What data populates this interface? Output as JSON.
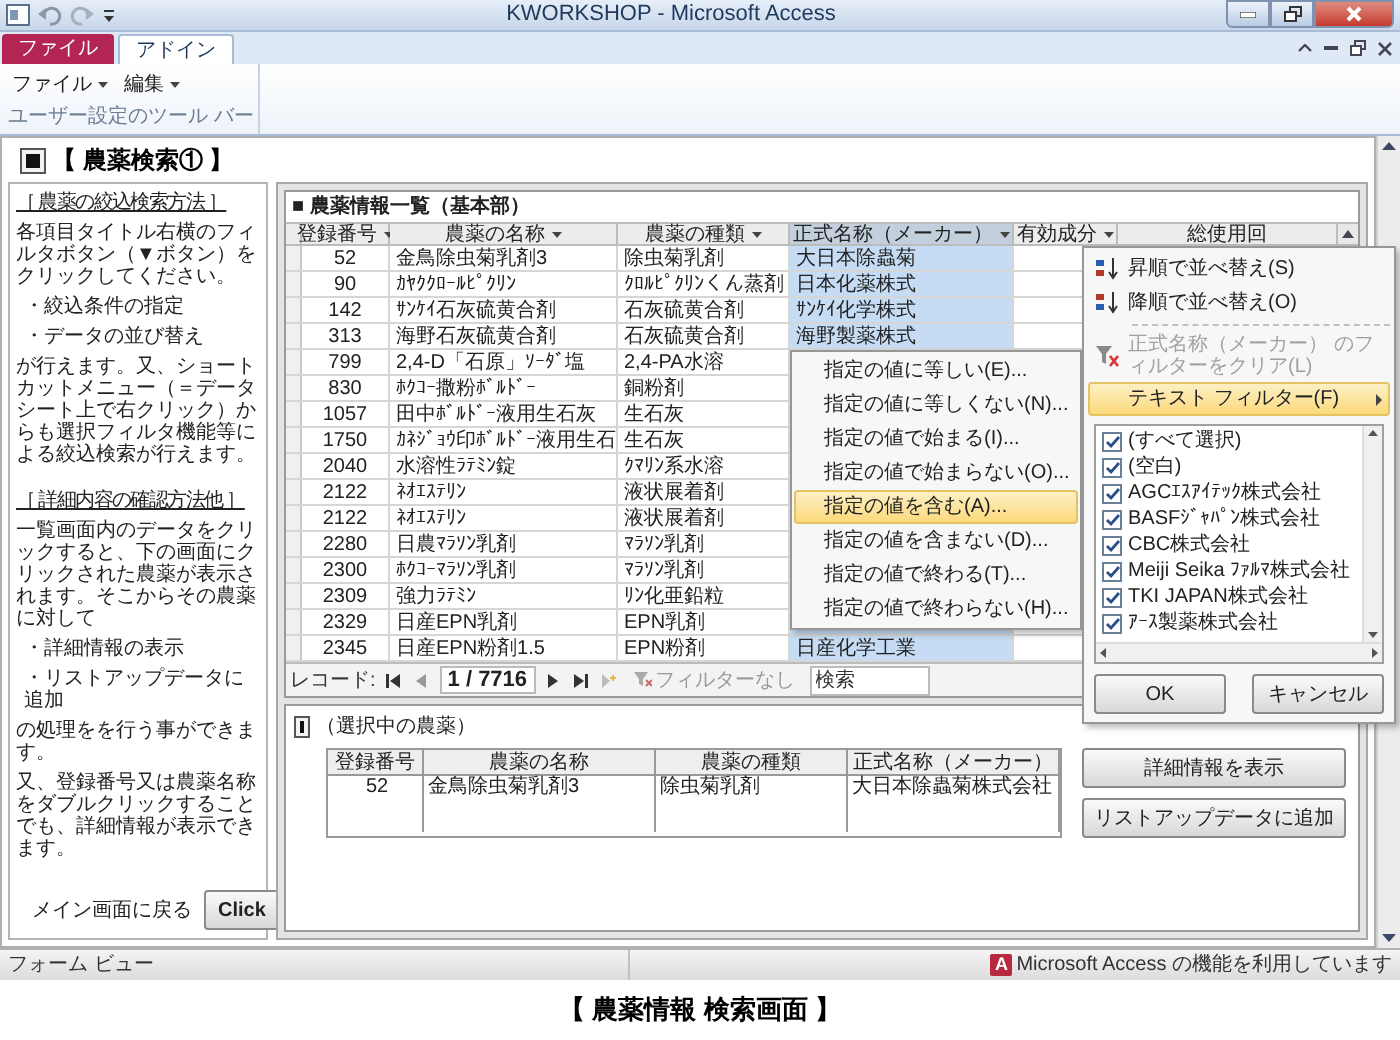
{
  "window": {
    "title": "KWORKSHOP - Microsoft Access"
  },
  "ribbon": {
    "tabs": [
      {
        "label": "ファイル",
        "kind": "file",
        "selected": false
      },
      {
        "label": "アドイン",
        "kind": "tab",
        "selected": true
      }
    ],
    "menus": [
      "ファイル",
      "編集"
    ],
    "group_label": "ユーザー設定のツール バー"
  },
  "form": {
    "title": "【 農薬検索① 】",
    "help": [
      {
        "kind": "heading",
        "text": "［ 農薬の絞込検索方法 ］"
      },
      {
        "kind": "paragraph",
        "text": "各項目タイトル右横のフィルタボタン（▼ボタン）をクリックしてください。"
      },
      {
        "kind": "bullet",
        "text": "・絞込条件の指定"
      },
      {
        "kind": "bullet",
        "text": "・データの並び替え"
      },
      {
        "kind": "paragraph",
        "text": "が行えます。又、ショートカットメニュー（＝データシート上で右クリック）からも選択フィルタ機能等による絞込検索が行えます。"
      },
      {
        "kind": "heading",
        "text": "［ 詳細内容の確認方法他 ］"
      },
      {
        "kind": "paragraph",
        "text": "一覧画面内のデータをクリックすると、下の画面にクリックされた農薬が表示されます。そこからその農薬に対して"
      },
      {
        "kind": "bullet",
        "text": "・詳細情報の表示"
      },
      {
        "kind": "bullet",
        "text": "・リストアップデータに追加"
      },
      {
        "kind": "paragraph",
        "text": "の処理をを行う事ができます。"
      },
      {
        "kind": "paragraph",
        "text": "又、登録番号又は農薬名称をダブルクリックすることでも、詳細情報が表示できます。"
      }
    ],
    "back": {
      "label": "メイン画面に戻る",
      "button": "Click"
    },
    "list": {
      "title": "■ 農薬情報一覧（基本部）",
      "columns": [
        {
          "label": "登録番号",
          "selected": false
        },
        {
          "label": "農薬の名称",
          "selected": false
        },
        {
          "label": "農薬の種類",
          "selected": false
        },
        {
          "label": "正式名称（メーカー）",
          "selected": true
        },
        {
          "label": "有効成分",
          "selected": false
        },
        {
          "label": "総使用回",
          "selected": false
        }
      ],
      "rows": [
        [
          "52",
          "金鳥除虫菊乳剤3",
          "除虫菊乳剤",
          "大日本除蟲菊"
        ],
        [
          "90",
          "ｶﾔｸｸﾛｰﾙﾋﾟｸﾘﾝ",
          "ｸﾛﾙﾋﾟｸﾘﾝくん蒸剤",
          "日本化薬株式"
        ],
        [
          "142",
          "ｻﾝｹｲ石灰硫黄合剤",
          "石灰硫黄合剤",
          "ｻﾝｹｲ化学株式"
        ],
        [
          "313",
          "海野石灰硫黄合剤",
          "石灰硫黄合剤",
          "海野製薬株式"
        ],
        [
          "799",
          "2,4-D「石原」ｿｰﾀﾞ塩",
          "2,4-PA水溶"
        ],
        [
          "830",
          "ﾎｸｺｰ撒粉ﾎﾞﾙﾄﾞｰ",
          "銅粉剤"
        ],
        [
          "1057",
          "田中ﾎﾞﾙﾄﾞｰ液用生石灰",
          "生石灰"
        ],
        [
          "1750",
          "ｶﾈｼﾞｮｳ印ﾎﾞﾙﾄﾞｰ液用生石",
          "生石灰"
        ],
        [
          "2040",
          "水溶性ﾗﾃﾐﾝ錠",
          "ｸﾏﾘﾝ系水溶"
        ],
        [
          "2122",
          "ﾈｵｴｽﾃﾘﾝ",
          "液状展着剤"
        ],
        [
          "2122",
          "ﾈｵｴｽﾃﾘﾝ",
          "液状展着剤"
        ],
        [
          "2280",
          "日農ﾏﾗｿﾝ乳剤",
          "ﾏﾗｿﾝ乳剤"
        ],
        [
          "2300",
          "ﾎｸｺｰﾏﾗｿﾝ乳剤",
          "ﾏﾗｿﾝ乳剤"
        ],
        [
          "2309",
          "強力ﾗﾃﾐﾝ",
          "ﾘﾝ化亜鉛粒"
        ],
        [
          "2329",
          "日産EPN乳剤",
          "EPN乳剤"
        ],
        [
          "2345",
          "日産EPN粉剤1.5",
          "EPN粉剤",
          "日産化学工業"
        ]
      ],
      "navigation": {
        "label": "レコード:",
        "position": "1 / 7716",
        "filter": "フィルターなし",
        "search": {
          "placeholder": "検索"
        }
      }
    },
    "selected": {
      "title": "（選択中の農薬）",
      "columns": [
        "登録番号",
        "農薬の名称",
        "農薬の種類",
        "正式名称（メーカー）"
      ],
      "row": [
        "52",
        "金鳥除虫菊乳剤3",
        "除虫菊乳剤",
        "大日本除蟲菊株式会社"
      ],
      "buttons": [
        "詳細情報を表示",
        "リストアップデータに追加"
      ]
    }
  },
  "filter_menu": {
    "items": [
      {
        "kind": "sort_asc",
        "label": "昇順で並べ替え(S)",
        "selected": false,
        "disabled": false
      },
      {
        "kind": "sort_desc",
        "label": "降順で並べ替え(O)",
        "selected": false,
        "disabled": false
      },
      {
        "kind": "clear_filter",
        "label": "正式名称（メーカー） のフィルターをクリア(L)",
        "selected": false,
        "disabled": true
      },
      {
        "kind": "submenu",
        "label": "テキスト フィルター(F)",
        "selected": true,
        "disabled": false
      }
    ],
    "values": [
      {
        "label": "(すべて選択)",
        "checked": true
      },
      {
        "label": "(空白)",
        "checked": true
      },
      {
        "label": "AGCｴｽｱｲﾃｯｸ株式会社",
        "checked": true
      },
      {
        "label": "BASFｼﾞｬﾊﾟﾝ株式会社",
        "checked": true
      },
      {
        "label": "CBC株式会社",
        "checked": true
      },
      {
        "label": "Meiji Seika ﾌｧﾙﾏ株式会社",
        "checked": true
      },
      {
        "label": "TKI JAPAN株式会社",
        "checked": true
      },
      {
        "label": "ｱｰｽ製薬株式会社",
        "checked": true
      }
    ],
    "buttons": [
      "OK",
      "キャンセル"
    ]
  },
  "text_filter_menu": {
    "items": [
      {
        "label": "指定の値に等しい(E)...",
        "selected": false
      },
      {
        "label": "指定の値に等しくない(N)...",
        "selected": false
      },
      {
        "label": "指定の値で始まる(I)...",
        "selected": false
      },
      {
        "label": "指定の値で始まらない(O)...",
        "selected": false
      },
      {
        "label": "指定の値を含む(A)...",
        "selected": true
      },
      {
        "label": "指定の値を含まない(D)...",
        "selected": false
      },
      {
        "label": "指定の値で終わる(T)...",
        "selected": false
      },
      {
        "label": "指定の値で終わらない(H)...",
        "selected": false
      }
    ]
  },
  "status_bar": {
    "view": "フォーム ビュー",
    "badge": "A",
    "message": "Microsoft Access の機能を利用しています"
  },
  "caption": "【 農薬情報 検索画面 】"
}
